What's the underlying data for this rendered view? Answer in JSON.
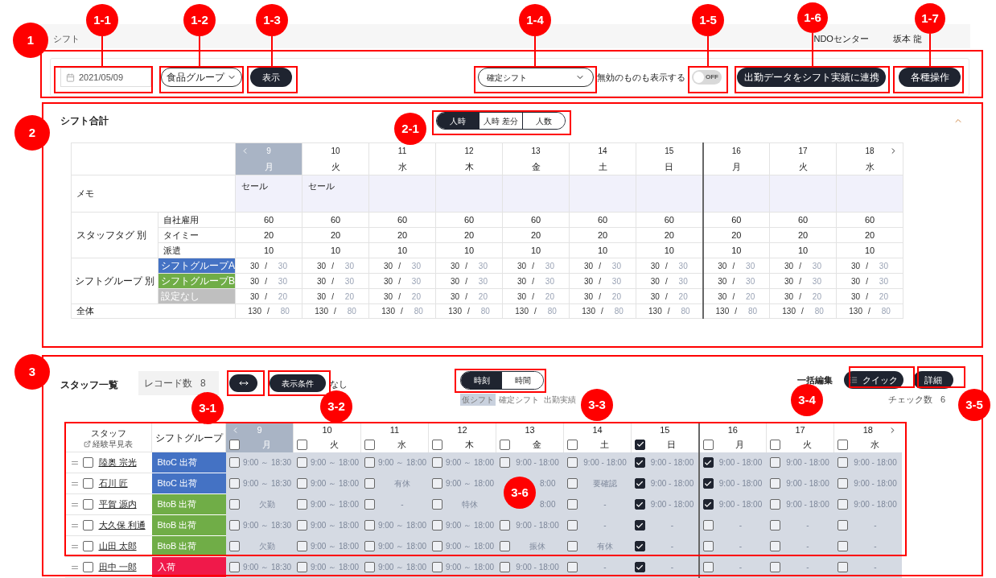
{
  "header": {
    "title": "シフト",
    "center": "NDOセンター",
    "user": "坂本 龍"
  },
  "toolbar": {
    "date": "2021/05/09",
    "group_select": "食品グループ",
    "show_button": "表示",
    "shift_select": "確定シフト",
    "show_invalid_label": "無効のものも表示する",
    "show_invalid": {
      "on": false,
      "label": "OFF"
    },
    "sync_button": "出勤データをシフト実績に連携",
    "actions_button": "各種操作"
  },
  "summary": {
    "title": "シフト合計",
    "expanded": true,
    "modes": [
      {
        "label": "人時",
        "selected": true
      },
      {
        "label": "人時 差分",
        "selected": false
      },
      {
        "label": "人数",
        "selected": false
      }
    ],
    "days": [
      {
        "date": "9",
        "weekday": "月",
        "selected": true,
        "memo": "セール"
      },
      {
        "date": "10",
        "weekday": "火",
        "selected": false,
        "memo": "セール"
      },
      {
        "date": "11",
        "weekday": "水",
        "selected": false
      },
      {
        "date": "12",
        "weekday": "木",
        "selected": false
      },
      {
        "date": "13",
        "weekday": "金",
        "selected": false
      },
      {
        "date": "14",
        "weekday": "土",
        "selected": false
      },
      {
        "date": "15",
        "weekday": "日",
        "selected": false
      },
      {
        "date": "16",
        "weekday": "月",
        "selected": false
      },
      {
        "date": "17",
        "weekday": "火",
        "selected": false
      },
      {
        "date": "18",
        "weekday": "水",
        "selected": false
      }
    ],
    "memo_label": "メモ",
    "tag_group": "スタッフタグ 別",
    "tags": [
      {
        "label": "自社雇用",
        "values": [
          "60",
          "60",
          "60",
          "60",
          "60",
          "60",
          "60",
          "60",
          "60",
          "60"
        ]
      },
      {
        "label": "タイミー",
        "values": [
          "20",
          "20",
          "20",
          "20",
          "20",
          "20",
          "20",
          "20",
          "20",
          "20"
        ]
      },
      {
        "label": "派遣",
        "values": [
          "10",
          "10",
          "10",
          "10",
          "10",
          "10",
          "10",
          "10",
          "10",
          "10"
        ]
      }
    ],
    "group_group": "シフトグループ 別",
    "groups": [
      {
        "label": "シフトグループA",
        "color": "#4472c4",
        "cells": [
          {
            "a": "30",
            "sep": "/",
            "b": "30"
          },
          {
            "a": "30",
            "sep": "/",
            "b": "30"
          },
          {
            "a": "30",
            "sep": "/",
            "b": "30"
          },
          {
            "a": "30",
            "sep": "/",
            "b": "30"
          },
          {
            "a": "30",
            "sep": "/",
            "b": "30"
          },
          {
            "a": "30",
            "sep": "/",
            "b": "30"
          },
          {
            "a": "30",
            "sep": "/",
            "b": "30"
          },
          {
            "a": "30",
            "sep": "/",
            "b": "30"
          },
          {
            "a": "30",
            "sep": "/",
            "b": "30"
          },
          {
            "a": "30",
            "sep": "/",
            "b": "30"
          }
        ]
      },
      {
        "label": "シフトグループB",
        "color": "#70ad47",
        "cells": [
          {
            "a": "30",
            "sep": "/",
            "b": "30"
          },
          {
            "a": "30",
            "sep": "/",
            "b": "30"
          },
          {
            "a": "30",
            "sep": "/",
            "b": "30"
          },
          {
            "a": "30",
            "sep": "/",
            "b": "30"
          },
          {
            "a": "30",
            "sep": "/",
            "b": "30"
          },
          {
            "a": "30",
            "sep": "/",
            "b": "30"
          },
          {
            "a": "30",
            "sep": "/",
            "b": "30"
          },
          {
            "a": "30",
            "sep": "/",
            "b": "30"
          },
          {
            "a": "30",
            "sep": "/",
            "b": "30"
          },
          {
            "a": "30",
            "sep": "/",
            "b": "30"
          }
        ]
      },
      {
        "label": "設定なし",
        "color": "#bfbfbf",
        "cells": [
          {
            "a": "30",
            "sep": "/",
            "b": "20"
          },
          {
            "a": "30",
            "sep": "/",
            "b": "20"
          },
          {
            "a": "30",
            "sep": "/",
            "b": "20"
          },
          {
            "a": "30",
            "sep": "/",
            "b": "20"
          },
          {
            "a": "30",
            "sep": "/",
            "b": "20"
          },
          {
            "a": "30",
            "sep": "/",
            "b": "20"
          },
          {
            "a": "30",
            "sep": "/",
            "b": "20"
          },
          {
            "a": "30",
            "sep": "/",
            "b": "20"
          },
          {
            "a": "30",
            "sep": "/",
            "b": "20"
          },
          {
            "a": "30",
            "sep": "/",
            "b": "20"
          }
        ]
      }
    ],
    "total": {
      "label": "全体",
      "cells": [
        {
          "a": "130",
          "sep": "/",
          "b": "80"
        },
        {
          "a": "130",
          "sep": "/",
          "b": "80"
        },
        {
          "a": "130",
          "sep": "/",
          "b": "80"
        },
        {
          "a": "130",
          "sep": "/",
          "b": "80"
        },
        {
          "a": "130",
          "sep": "/",
          "b": "80"
        },
        {
          "a": "130",
          "sep": "/",
          "b": "80"
        },
        {
          "a": "130",
          "sep": "/",
          "b": "80"
        },
        {
          "a": "130",
          "sep": "/",
          "b": "80"
        },
        {
          "a": "130",
          "sep": "/",
          "b": "80"
        },
        {
          "a": "130",
          "sep": "/",
          "b": "80"
        }
      ]
    }
  },
  "staff": {
    "title": "スタッフ一覧",
    "record_label": "レコード数",
    "record_count": "8",
    "filter_button": "表示条件",
    "filter_value": "なし",
    "view_modes": [
      {
        "label": "時刻",
        "selected": true
      },
      {
        "label": "時間",
        "selected": false
      }
    ],
    "legend": [
      {
        "label": "仮シフト",
        "selected": true
      },
      {
        "label": "確定シフト",
        "selected": false
      },
      {
        "label": "出勤実績",
        "selected": false
      }
    ],
    "bulk_label": "一括編集",
    "quick_button": "クイック",
    "detail_button": "詳細",
    "check_label": "チェック数",
    "check_count": "6",
    "columns": {
      "staff": "スタッフ",
      "link": "経験早見表",
      "group": "シフトグループ"
    },
    "days": [
      {
        "date": "9",
        "weekday": "月",
        "selected": true,
        "checked": false
      },
      {
        "date": "10",
        "weekday": "火",
        "selected": false,
        "checked": false
      },
      {
        "date": "11",
        "weekday": "水",
        "selected": false,
        "checked": false
      },
      {
        "date": "12",
        "weekday": "木",
        "selected": false,
        "checked": false
      },
      {
        "date": "13",
        "weekday": "金",
        "selected": false,
        "checked": false
      },
      {
        "date": "14",
        "weekday": "土",
        "selected": false,
        "checked": false
      },
      {
        "date": "15",
        "weekday": "日",
        "selected": false,
        "checked": true
      },
      {
        "date": "16",
        "weekday": "月",
        "selected": false,
        "checked": false
      },
      {
        "date": "17",
        "weekday": "火",
        "selected": false,
        "checked": false
      },
      {
        "date": "18",
        "weekday": "水",
        "selected": false,
        "checked": false
      }
    ],
    "rows": [
      {
        "name": "陸奥 宗光",
        "group": "BtoC 出荷",
        "color": "#4472c4",
        "checked": false,
        "cells": [
          {
            "text": "9:00 ～ 18:30",
            "checked": false
          },
          {
            "text": "9:00 ～ 18:00",
            "checked": false
          },
          {
            "text": "9:00 ～ 18:00",
            "checked": false
          },
          {
            "text": "9:00 ～ 18:00",
            "checked": false
          },
          {
            "text": "9:00 - 18:00",
            "checked": false
          },
          {
            "text": "9:00 - 18:00",
            "checked": false
          },
          {
            "text": "9:00 - 18:00",
            "checked": true
          },
          {
            "text": "9:00 - 18:00",
            "checked": true
          },
          {
            "text": "9:00 - 18:00",
            "checked": false
          },
          {
            "text": "9:00 - 18:00",
            "checked": false
          }
        ]
      },
      {
        "name": "石川 匠",
        "group": "BtoC 出荷",
        "color": "#4472c4",
        "checked": false,
        "cells": [
          {
            "text": "9:00 ～ 18:30",
            "checked": false
          },
          {
            "text": "9:00 ～ 18:00",
            "checked": false
          },
          {
            "text": "有休",
            "checked": false
          },
          {
            "text": "9:00 ～ 18:00",
            "checked": false
          },
          {
            "text": "8:00"
          },
          {
            "text": "要確認",
            "checked": false
          },
          {
            "text": "9:00 - 18:00",
            "checked": true
          },
          {
            "text": "9:00 - 18:00",
            "checked": true
          },
          {
            "text": "9:00 - 18:00",
            "checked": false
          },
          {
            "text": "9:00 - 18:00",
            "checked": false
          }
        ]
      },
      {
        "name": "平賀 源内",
        "group": "BtoB 出荷",
        "color": "#70ad47",
        "checked": false,
        "cells": [
          {
            "text": "欠勤",
            "checked": false
          },
          {
            "text": "9:00 ～ 18:00",
            "checked": false
          },
          {
            "text": "-",
            "checked": false
          },
          {
            "text": "特休",
            "checked": false
          },
          {
            "text": "8:00"
          },
          {
            "text": "-",
            "checked": false
          },
          {
            "text": "9:00 - 18:00",
            "checked": true
          },
          {
            "text": "9:00 - 18:00",
            "checked": true
          },
          {
            "text": "9:00 - 18:00",
            "checked": false
          },
          {
            "text": "9:00 - 18:00",
            "checked": false
          }
        ]
      },
      {
        "name": "大久保 利通",
        "group": "BtoB 出荷",
        "color": "#70ad47",
        "checked": false,
        "cells": [
          {
            "text": "9:00 ～ 18:30",
            "checked": false
          },
          {
            "text": "9:00 ～ 18:00",
            "checked": false
          },
          {
            "text": "9:00 ～ 18:00",
            "checked": false
          },
          {
            "text": "9:00 ～ 18:00",
            "checked": false
          },
          {
            "text": "9:00 - 18:00",
            "checked": false
          },
          {
            "text": "-",
            "checked": false
          },
          {
            "text": "-",
            "checked": true
          },
          {
            "text": "-",
            "checked": false
          },
          {
            "text": "-",
            "checked": false
          },
          {
            "text": "-",
            "checked": false
          }
        ]
      },
      {
        "name": "山田 太郎",
        "group": "BtoB 出荷",
        "color": "#70ad47",
        "checked": false,
        "cells": [
          {
            "text": "欠勤",
            "checked": false
          },
          {
            "text": "9:00 ～ 18:00",
            "checked": false
          },
          {
            "text": "9:00 ～ 18:00",
            "checked": false
          },
          {
            "text": "9:00 ～ 18:00",
            "checked": false
          },
          {
            "text": "振休",
            "checked": false
          },
          {
            "text": "有休",
            "checked": false
          },
          {
            "text": "-",
            "checked": true
          },
          {
            "text": "-",
            "checked": false
          },
          {
            "text": "-",
            "checked": false
          },
          {
            "text": "-",
            "checked": false
          }
        ]
      },
      {
        "name": "田中 一郎",
        "group": "入荷",
        "color": "#f0194a",
        "checked": false,
        "cells": [
          {
            "text": "9:00 ～ 18:30",
            "checked": false
          },
          {
            "text": "9:00 ～ 18:00",
            "checked": false
          },
          {
            "text": "9:00 ～ 18:00",
            "checked": false
          },
          {
            "text": "9:00 ～ 18:00",
            "checked": false
          },
          {
            "text": "9:00 - 18:00",
            "checked": false
          },
          {
            "text": "-",
            "checked": false
          },
          {
            "text": "-",
            "checked": true
          },
          {
            "text": "-",
            "checked": false
          },
          {
            "text": "-",
            "checked": false
          },
          {
            "text": "-",
            "checked": false
          }
        ]
      }
    ]
  },
  "annotations": [
    {
      "label": "1"
    },
    {
      "label": "1-1"
    },
    {
      "label": "1-2"
    },
    {
      "label": "1-3"
    },
    {
      "label": "1-4"
    },
    {
      "label": "1-5"
    },
    {
      "label": "1-6"
    },
    {
      "label": "1-7"
    },
    {
      "label": "2"
    },
    {
      "label": "2-1"
    },
    {
      "label": "3"
    },
    {
      "label": "3-1"
    },
    {
      "label": "3-2"
    },
    {
      "label": "3-3"
    },
    {
      "label": "3-4"
    },
    {
      "label": "3-5"
    },
    {
      "label": "3-6"
    }
  ]
}
